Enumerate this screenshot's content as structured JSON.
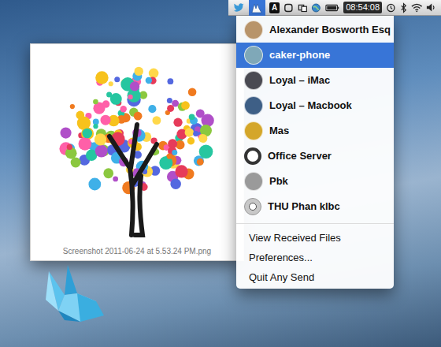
{
  "menubar": {
    "anysend_active": true,
    "adobe_glyph": "A",
    "clock": "08:54:08"
  },
  "menu": {
    "contacts": [
      {
        "name": "Alexander Bosworth Esq",
        "selected": false,
        "kind": "photo",
        "color": "#b8946a"
      },
      {
        "name": "caker-phone",
        "selected": true,
        "kind": "photo",
        "color": "#7fa8b8"
      },
      {
        "name": "Loyal – iMac",
        "selected": false,
        "kind": "photo",
        "color": "#4a4a52"
      },
      {
        "name": "Loyal – Macbook",
        "selected": false,
        "kind": "photo",
        "color": "#3e5f86"
      },
      {
        "name": "Mas",
        "selected": false,
        "kind": "photo",
        "color": "#d4a62a"
      },
      {
        "name": "Office Server",
        "selected": false,
        "kind": "server",
        "color": "#333333"
      },
      {
        "name": "Pbk",
        "selected": false,
        "kind": "photo",
        "color": "#9a9a9a"
      },
      {
        "name": "THU Phan klbc",
        "selected": false,
        "kind": "mascot",
        "color": "#c8c8c8"
      }
    ],
    "actions": [
      "View Received Files",
      "Preferences...",
      "Quit Any Send"
    ]
  },
  "preview": {
    "caption": "Screenshot 2011-06-24 at 5.53.24 PM.png"
  }
}
